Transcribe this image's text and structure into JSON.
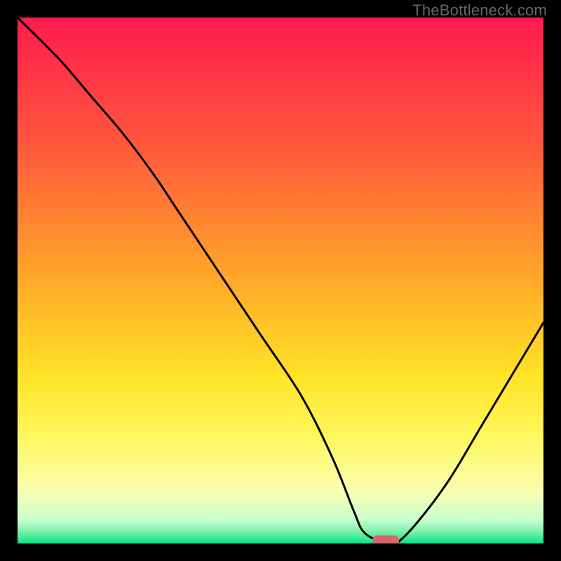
{
  "watermark": "TheBottleneck.com",
  "chart_data": {
    "type": "line",
    "title": "",
    "xlabel": "",
    "ylabel": "",
    "xlim": [
      0,
      100
    ],
    "ylim": [
      0,
      100
    ],
    "grid": false,
    "legend": false,
    "background_gradient": {
      "stops": [
        {
          "pos": 0.0,
          "color": "#ff1a4d"
        },
        {
          "pos": 0.25,
          "color": "#ff5a3c"
        },
        {
          "pos": 0.47,
          "color": "#ffa02a"
        },
        {
          "pos": 0.68,
          "color": "#ffe326"
        },
        {
          "pos": 0.8,
          "color": "#fff85f"
        },
        {
          "pos": 0.9,
          "color": "#faffb0"
        },
        {
          "pos": 0.955,
          "color": "#c9ffd0"
        },
        {
          "pos": 0.978,
          "color": "#7af0a8"
        },
        {
          "pos": 1.0,
          "color": "#00e887"
        }
      ]
    },
    "series": [
      {
        "name": "bottleneck-curve",
        "x": [
          0,
          8,
          14,
          20,
          26,
          30,
          38,
          46,
          54,
          60,
          64,
          66,
          70,
          72,
          76,
          82,
          88,
          94,
          100
        ],
        "y": [
          100,
          92,
          85,
          78,
          70,
          64,
          52,
          40,
          28,
          16,
          6,
          2,
          0,
          0,
          4,
          12,
          22,
          32,
          42
        ]
      }
    ],
    "marker": {
      "name": "optimal-point",
      "x": 70,
      "y": 0,
      "color": "#d9646e",
      "shape": "rounded-rect"
    }
  }
}
